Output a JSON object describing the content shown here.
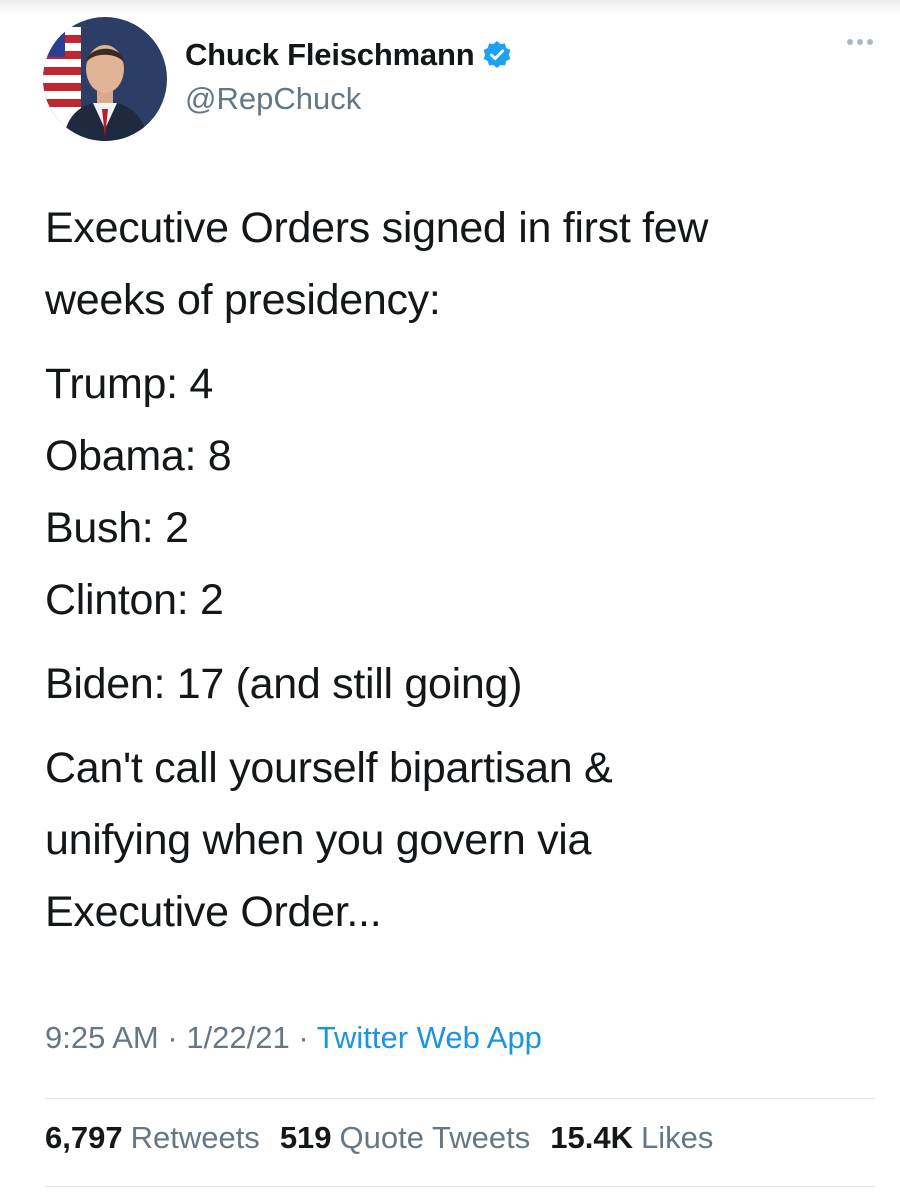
{
  "author": {
    "display_name": "Chuck Fleischmann",
    "handle": "@RepChuck",
    "verified_icon": "verified-badge-icon",
    "accent": "#1da1f2"
  },
  "tweet": {
    "intro_line1": "Executive Orders signed in first few",
    "intro_line2": "weeks of presidency:",
    "counts": [
      "Trump: 4",
      "Obama: 8",
      "Bush: 2",
      "Clinton: 2"
    ],
    "biden": "Biden: 17 (and still going)",
    "closing_line1": "Can't call yourself bipartisan &",
    "closing_line2": "unifying when you govern via",
    "closing_line3": "Executive Order..."
  },
  "meta": {
    "time": "9:25 AM",
    "sep1": "·",
    "date": "1/22/21",
    "sep2": "·",
    "source": "Twitter Web App"
  },
  "stats": {
    "retweets_count": "6,797",
    "retweets_label": "Retweets",
    "quotes_count": "519",
    "quotes_label": "Quote Tweets",
    "likes_count": "15.4K",
    "likes_label": "Likes"
  },
  "colors": {
    "text": "#14171a",
    "secondary": "#657786",
    "link": "#1b95e0"
  }
}
